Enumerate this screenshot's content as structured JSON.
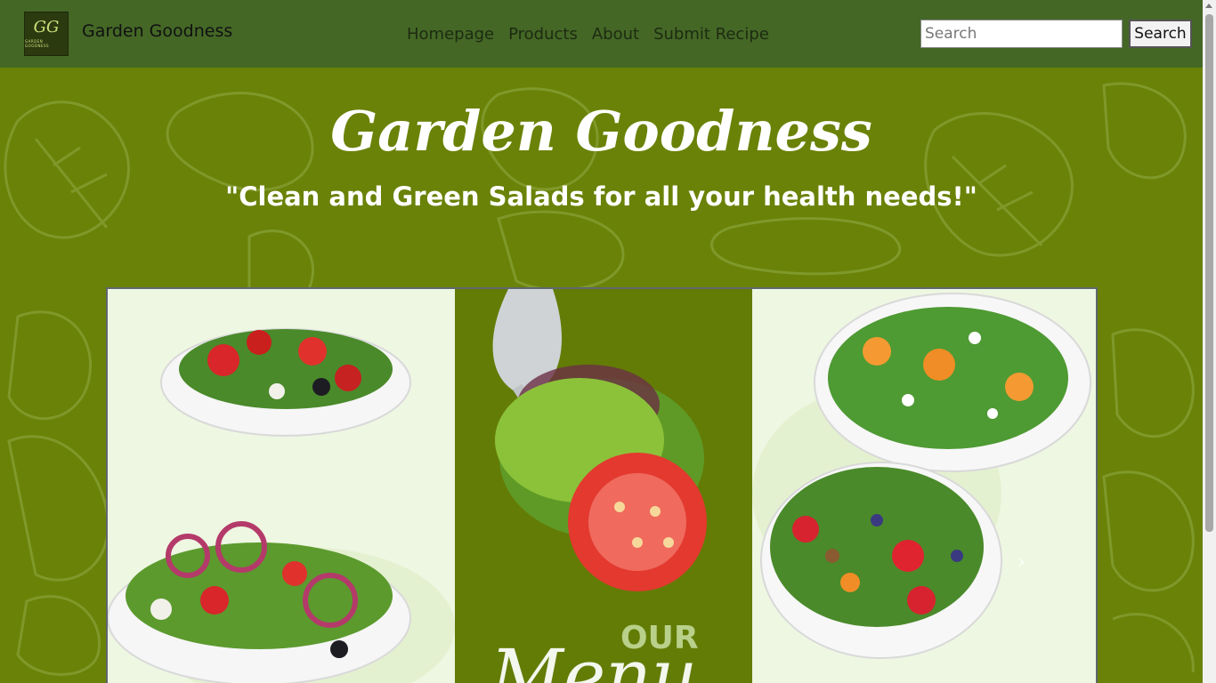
{
  "header": {
    "brand": "Garden Goodness",
    "logo_mark": "GG",
    "logo_text": "GARDEN GOODNESS",
    "nav": [
      "Homepage",
      "Products",
      "About",
      "Submit Recipe"
    ],
    "search": {
      "placeholder": "Search",
      "button_label": "Search"
    }
  },
  "hero": {
    "title": "Garden Goodness",
    "tagline": "\"Clean and Green Salads for all your health needs!\""
  },
  "banner": {
    "our": "OUR",
    "menu": "Menu",
    "next_icon": "chevron-right-icon"
  },
  "colors": {
    "navbar": "#446726",
    "hero_bg": "#6a8207",
    "banner_mid": "#637c06",
    "banner_side": "#eef7e2"
  }
}
